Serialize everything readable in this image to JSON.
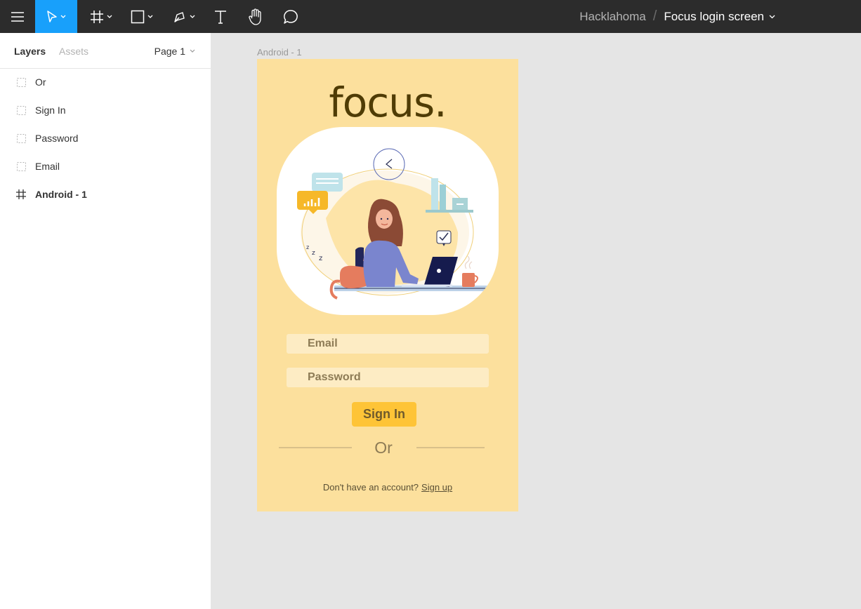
{
  "toolbar": {
    "icons": [
      "menu-icon",
      "move-tool-icon",
      "frame-tool-icon",
      "shape-tool-icon",
      "pen-tool-icon",
      "text-tool-icon",
      "hand-tool-icon",
      "comment-tool-icon"
    ],
    "accent": "#18a0fb",
    "project": "Hacklahoma",
    "separator": "/",
    "file": "Focus login screen"
  },
  "panel": {
    "tabs": [
      "Layers",
      "Assets"
    ],
    "page": "Page 1",
    "layers": [
      {
        "label": "Or",
        "icon": "group-icon"
      },
      {
        "label": "Sign In",
        "icon": "group-icon"
      },
      {
        "label": "Password",
        "icon": "group-icon"
      },
      {
        "label": "Email",
        "icon": "group-icon"
      },
      {
        "label": "Android - 1",
        "icon": "frame-icon"
      }
    ]
  },
  "canvas": {
    "frame_label": "Android - 1",
    "app": {
      "logo": "focus.",
      "email_placeholder": "Email",
      "password_placeholder": "Password",
      "signin_label": "Sign In",
      "or_label": "Or",
      "signup_prompt": "Don't have an account?",
      "signup_link": "Sign up",
      "colors": {
        "background": "#fce09d",
        "button": "#fec437",
        "field": "#fdecc4",
        "logo": "#4f3c05"
      }
    }
  }
}
